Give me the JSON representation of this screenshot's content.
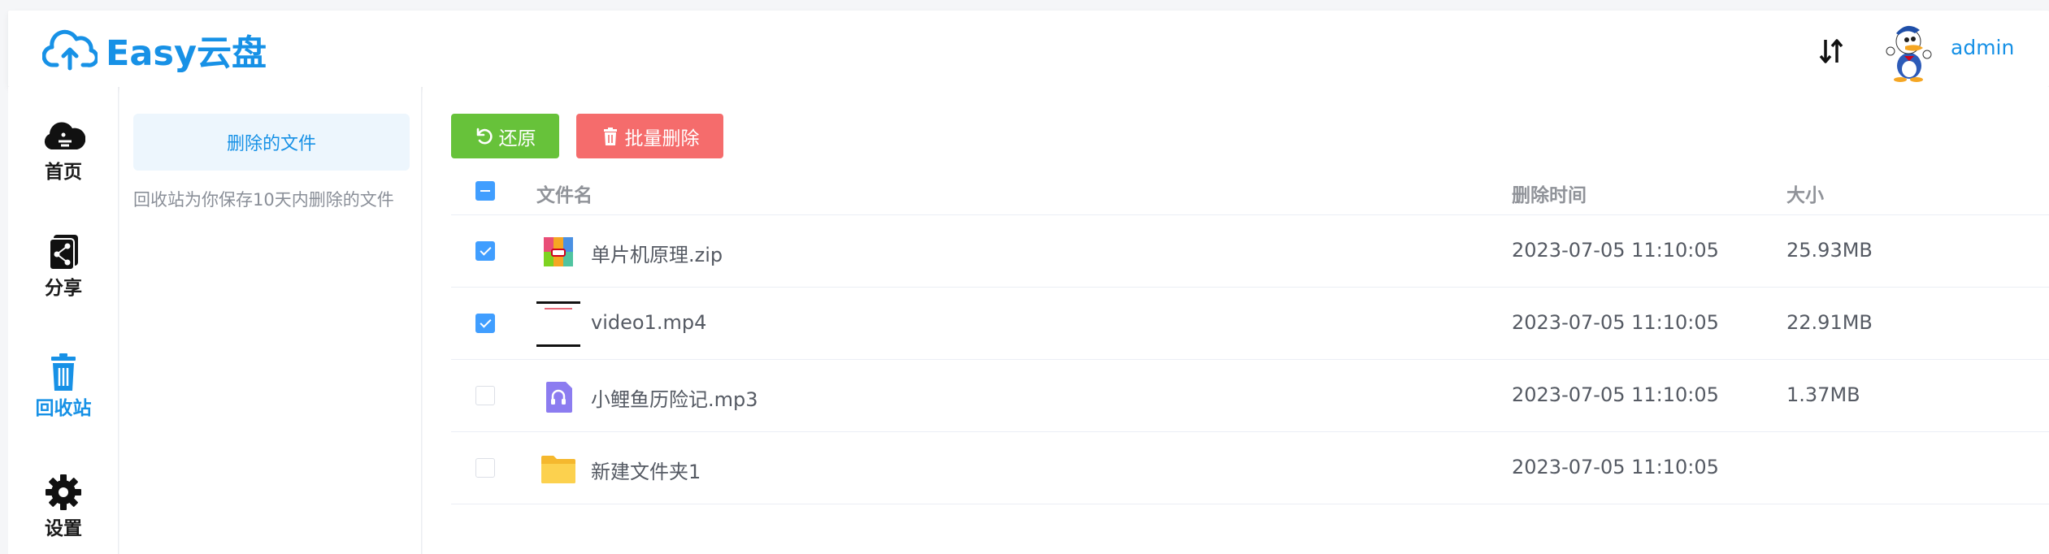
{
  "app": {
    "title": "Easy云盘",
    "username": "admin"
  },
  "icons": {
    "logo": "cloud-upload-icon",
    "sort": "sort-arrows-icon",
    "avatar": "donald-duck-avatar"
  },
  "colors": {
    "brand": "#1791e6",
    "restore_button": "#67c23a",
    "delete_button": "#f56c6c",
    "checkbox_checked": "#409eff"
  },
  "nav": {
    "items": [
      {
        "label": "首页",
        "icon": "cloud-home-icon",
        "active": false
      },
      {
        "label": "分享",
        "icon": "share-icon",
        "active": false
      },
      {
        "label": "回收站",
        "icon": "trash-icon",
        "active": true
      },
      {
        "label": "设置",
        "icon": "gear-icon",
        "active": false
      }
    ]
  },
  "subnav": {
    "active_label": "删除的文件",
    "tip": "回收站为你保存10天内删除的文件"
  },
  "toolbar": {
    "restore_label": "还原",
    "batch_delete_label": "批量删除"
  },
  "table": {
    "header_checkbox": "indeterminate",
    "columns": [
      "文件名",
      "删除时间",
      "大小"
    ],
    "rows": [
      {
        "checked": true,
        "icon": "zip-file-icon",
        "name": "单片机原理.zip",
        "deleted_at": "2023-07-05 11:10:05",
        "size": "25.93MB"
      },
      {
        "checked": true,
        "icon": "video-thumbnail",
        "name": "video1.mp4",
        "deleted_at": "2023-07-05 11:10:05",
        "size": "22.91MB"
      },
      {
        "checked": false,
        "icon": "audio-file-icon",
        "name": "小鲤鱼历险记.mp3",
        "deleted_at": "2023-07-05 11:10:05",
        "size": "1.37MB"
      },
      {
        "checked": false,
        "icon": "folder-icon",
        "name": "新建文件夹1",
        "deleted_at": "2023-07-05 11:10:05",
        "size": ""
      }
    ]
  }
}
